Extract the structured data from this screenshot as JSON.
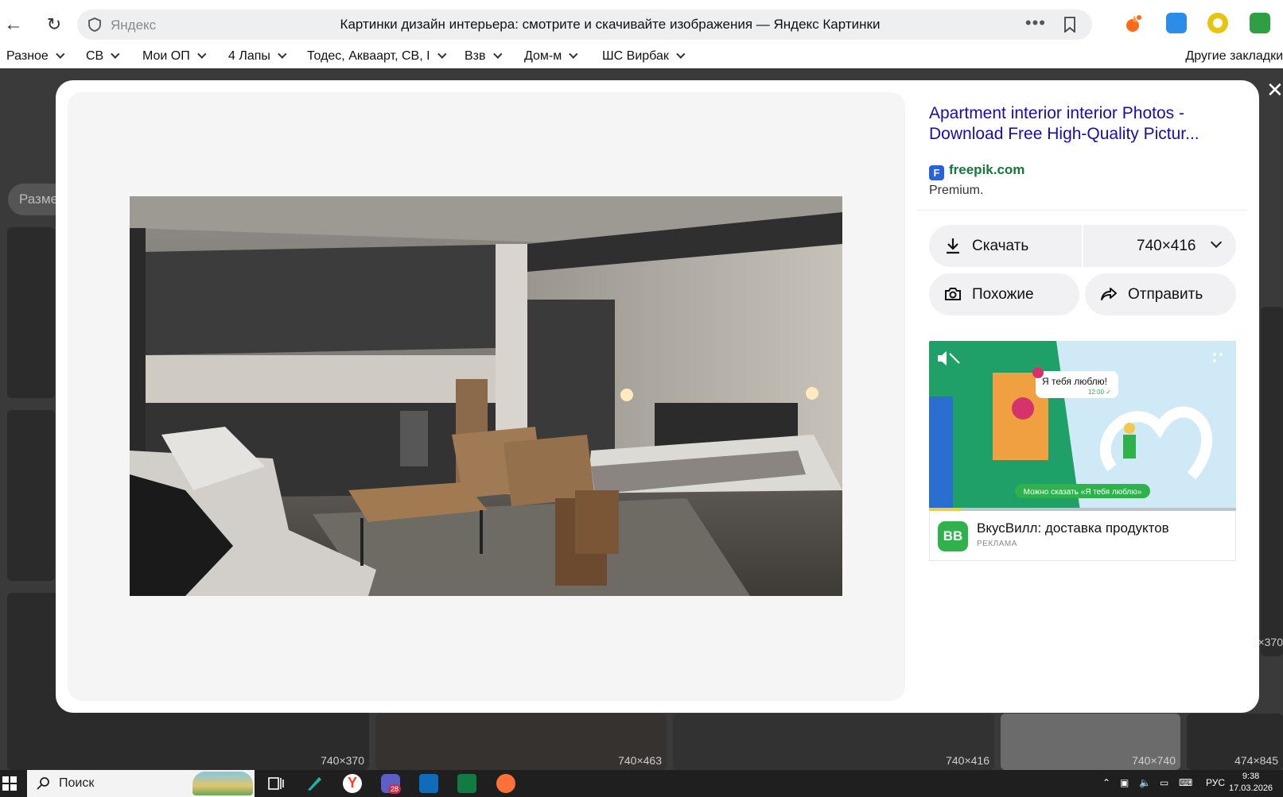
{
  "browser": {
    "host": "Яндекс",
    "title": "Картинки дизайн интерьера: смотрите и скачивайте изображения — Яндекс Картинки",
    "more": "•••"
  },
  "bookmarks": {
    "items": [
      {
        "label": "Разное"
      },
      {
        "label": "СВ"
      },
      {
        "label": "Мои ОП"
      },
      {
        "label": "4 Лапы"
      },
      {
        "label": "Тодес, Акваарт, СВ, I"
      },
      {
        "label": "Взв"
      },
      {
        "label": "Дом-м"
      },
      {
        "label": "ШС Вирбак"
      }
    ],
    "other": "Другие закладки"
  },
  "background": {
    "chip": "Разме",
    "tile_sizes": [
      "740×370",
      "740×463",
      "740×416",
      "740×740",
      "474×845",
      "×370"
    ]
  },
  "modal": {
    "close": "✕",
    "image_alt": "Apartment interior with kitchen, bed and sofa",
    "info": {
      "title_line1": "Apartment interior interior Photos -",
      "title_line2": "Download Free High-Quality Pictur...",
      "source": "freepik.com",
      "source_icon": "F",
      "note": "Premium.",
      "download_label": "Скачать",
      "size_label": "740×416",
      "similar_label": "Похожие",
      "share_label": "Отправить"
    },
    "ad": {
      "bubble_text": "Я тебя люблю!",
      "bubble_time": "12:00 ✓",
      "banner_caption": "Можно сказать «Я тебя люблю»",
      "logo": "ВВ",
      "title": "ВкусВилл: доставка продуктов",
      "label": "РЕКЛАМА"
    }
  },
  "taskbar": {
    "search_label": "Поиск",
    "teams_badge": "28",
    "lang": "РУС",
    "time": "9:38",
    "date": "17.03.2026"
  },
  "colors": {
    "link": "#1a0dab",
    "source": "#16773c",
    "ad_green": "#2fb24c",
    "accent": "#fc3f1d"
  }
}
